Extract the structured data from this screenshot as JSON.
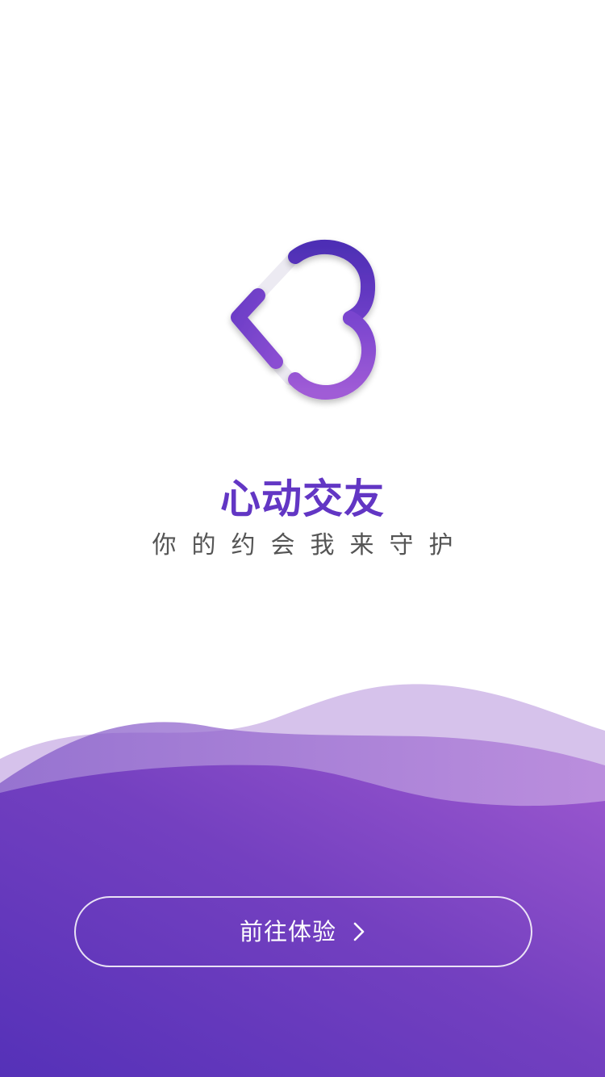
{
  "app": {
    "title": "心动交友",
    "slogan": "你的约会我来守护"
  },
  "cta": {
    "label": "前往体验",
    "icon": "chevron-right-icon"
  },
  "logo": {
    "icon": "heart-logo-icon"
  },
  "colors": {
    "brand_purple": "#6236C4",
    "brand_light": "#9B59D0",
    "wave_light": "#D3BFEA",
    "slogan_gray": "#555555",
    "background": "#FFFFFF"
  }
}
